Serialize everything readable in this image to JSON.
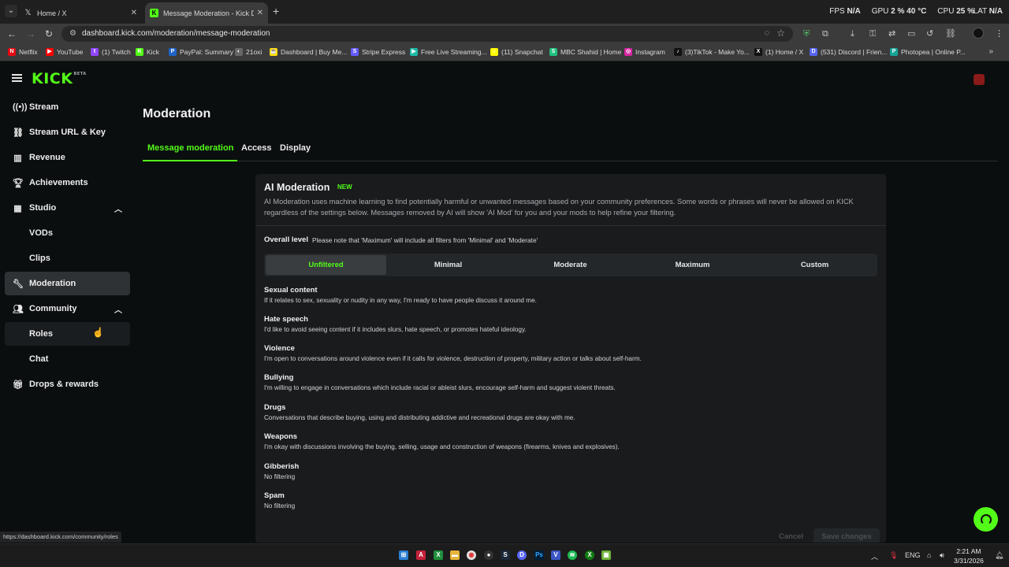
{
  "browser": {
    "tabs": [
      {
        "label": "Home / X",
        "icon": "x-logo-icon"
      },
      {
        "label": "Message Moderation - Kick Da",
        "icon": "kick-logo-icon",
        "active": true
      }
    ],
    "new_tab": "+",
    "url": "dashboard.kick.com/moderation/message-moderation",
    "bookmarks": [
      {
        "label": "Netflix",
        "color": "#e50914",
        "glyph": "N"
      },
      {
        "label": "YouTube",
        "color": "#ff0000",
        "glyph": "▶"
      },
      {
        "label": "(1) Twitch",
        "color": "#9146ff",
        "glyph": "t"
      },
      {
        "label": "Kick",
        "color": "#53fc18",
        "glyph": "K"
      },
      {
        "label": "PayPal: Summary",
        "color": "#1f64c7",
        "glyph": "P"
      },
      {
        "label": "21oxi",
        "color": "#666666",
        "glyph": "◐"
      },
      {
        "label": "Dashboard | Buy Me...",
        "color": "#ffdd00",
        "glyph": "☕"
      },
      {
        "label": "Stripe Express",
        "color": "#635bff",
        "glyph": "S"
      },
      {
        "label": "Free Live Streaming...",
        "color": "#1db9a7",
        "glyph": "▶"
      },
      {
        "label": "(11) Snapchat",
        "color": "#fffc00",
        "glyph": "☺"
      },
      {
        "label": "MBC Shahid | Home",
        "color": "#1fbf7f",
        "glyph": "S"
      },
      {
        "label": "Instagram",
        "color": "#d6249f",
        "glyph": "◎"
      },
      {
        "label": "(3)TikTok - Make Yo...",
        "color": "#111111",
        "glyph": "♪"
      },
      {
        "label": "(1) Home / X",
        "color": "#111111",
        "glyph": "X"
      },
      {
        "label": "(531) Discord | Frien...",
        "color": "#5865f2",
        "glyph": "D"
      },
      {
        "label": "Photopea | Online P...",
        "color": "#18a497",
        "glyph": "P"
      }
    ],
    "bookmarks_more": "»",
    "overlay": {
      "fps_label": "FPS",
      "fps_value": "N/A",
      "gpu_label": "GPU",
      "gpu_usage": "2 %",
      "gpu_temp": "40 °C",
      "cpu_label": "CPU",
      "cpu_usage": "25 %",
      "lat_label": "LAT",
      "lat_value": "N/A"
    }
  },
  "app": {
    "logo": "KICK",
    "logo_badge": "BETA",
    "accent": "#53fc18"
  },
  "sidebar": {
    "items": [
      {
        "label": "Stream",
        "icon": "broadcast-icon"
      },
      {
        "label": "Stream URL & Key",
        "icon": "link-icon"
      },
      {
        "label": "Revenue",
        "icon": "chart-icon"
      },
      {
        "label": "Achievements",
        "icon": "trophy-icon"
      },
      {
        "label": "Studio",
        "icon": "film-icon"
      },
      {
        "label": "VODs"
      },
      {
        "label": "Clips"
      },
      {
        "label": "Moderation",
        "icon": "wrench-icon"
      },
      {
        "label": "Community",
        "icon": "people-icon"
      },
      {
        "label": "Roles"
      },
      {
        "label": "Chat"
      },
      {
        "label": "Drops & rewards",
        "icon": "gift-icon"
      }
    ]
  },
  "main": {
    "title": "Moderation",
    "tabs": [
      {
        "label": "Message moderation"
      },
      {
        "label": "Access"
      },
      {
        "label": "Display"
      }
    ]
  },
  "ai_moderation": {
    "title": "AI Moderation",
    "badge": "NEW",
    "description": "AI Moderation uses machine learning to find potentially harmful or unwanted messages based on your community preferences. Some words or phrases will never be allowed on KICK regardless of the settings below. Messages removed by AI will show 'AI Mod' for you and your mods to help refine your filtering.",
    "overall_label": "Overall level",
    "overall_note": "Please note that 'Maximum' will include all filters from 'Minimal' and 'Moderate'",
    "levels": [
      "Unfiltered",
      "Minimal",
      "Moderate",
      "Maximum",
      "Custom"
    ],
    "selected_level": "Unfiltered",
    "categories": [
      {
        "name": "Sexual content",
        "desc": "If it relates to sex, sexuality or nudity in any way, I'm ready to have people discuss it around me."
      },
      {
        "name": "Hate speech",
        "desc": "I'd like to avoid seeing content if it includes slurs, hate speech, or promotes hateful ideology."
      },
      {
        "name": "Violence",
        "desc": "I'm open to conversations around violence even if it calls for violence, destruction of property, military action or talks about self-harm."
      },
      {
        "name": "Bullying",
        "desc": "I'm willing to engage in conversations which include racial or ableist slurs, encourage self-harm and suggest violent threats."
      },
      {
        "name": "Drugs",
        "desc": "Conversations that describe buying, using and distributing addictive and recreational drugs are okay with me."
      },
      {
        "name": "Weapons",
        "desc": "I'm okay with discussions involving the buying, selling, usage and construction of weapons (firearms, knives and explosives)."
      },
      {
        "name": "Gibberish",
        "desc": "No filtering"
      },
      {
        "name": "Spam",
        "desc": "No filtering"
      }
    ],
    "cancel_label": "Cancel",
    "save_label": "Save changes"
  },
  "status_url": "https://dashboard.kick.com/community/roles",
  "taskbar": {
    "lang": "ENG",
    "time": "2:21 AM",
    "date": "3/31/2026"
  }
}
